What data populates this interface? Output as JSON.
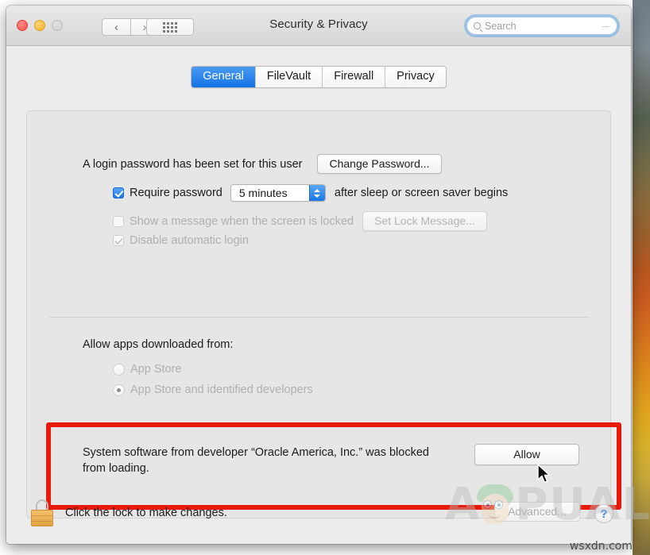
{
  "window": {
    "title": "Security & Privacy",
    "traffic_lights": [
      "close",
      "minimize",
      "zoom-disabled"
    ],
    "nav": {
      "back": "‹",
      "forward": "›",
      "grid": "grid-icon"
    },
    "search": {
      "placeholder": "Search",
      "value": "",
      "icon": "search-icon"
    }
  },
  "tabs": [
    {
      "label": "General",
      "active": true
    },
    {
      "label": "FileVault",
      "active": false
    },
    {
      "label": "Firewall",
      "active": false
    },
    {
      "label": "Privacy",
      "active": false
    }
  ],
  "general": {
    "login_password_text": "A login password has been set for this user",
    "change_password_button": "Change Password...",
    "require_password": {
      "label": "Require password",
      "checked": true,
      "delay_value": "5 minutes",
      "suffix": "after sleep or screen saver begins"
    },
    "show_message": {
      "label": "Show a message when the screen is locked",
      "checked": false,
      "button": "Set Lock Message...",
      "disabled": true
    },
    "disable_auto_login": {
      "label": "Disable automatic login",
      "checked": true,
      "disabled": true
    },
    "allow_apps_heading": "Allow apps downloaded from:",
    "allow_apps_options": [
      {
        "label": "App Store",
        "selected": false,
        "disabled": true
      },
      {
        "label": "App Store and identified developers",
        "selected": true,
        "disabled": true
      }
    ],
    "blocked_notice": {
      "line1": "System software from developer “Oracle America, Inc.” was blocked",
      "line2": "from loading.",
      "allow_button": "Allow",
      "highlight_color": "#e81a0c"
    }
  },
  "footer": {
    "lock_icon": "lock-closed-icon",
    "lock_label": "Click the lock to make changes.",
    "advanced_button": "Advanced...",
    "help_button": "?"
  },
  "watermark": {
    "brand": "APPUALS",
    "site": "wsxdn.com"
  }
}
